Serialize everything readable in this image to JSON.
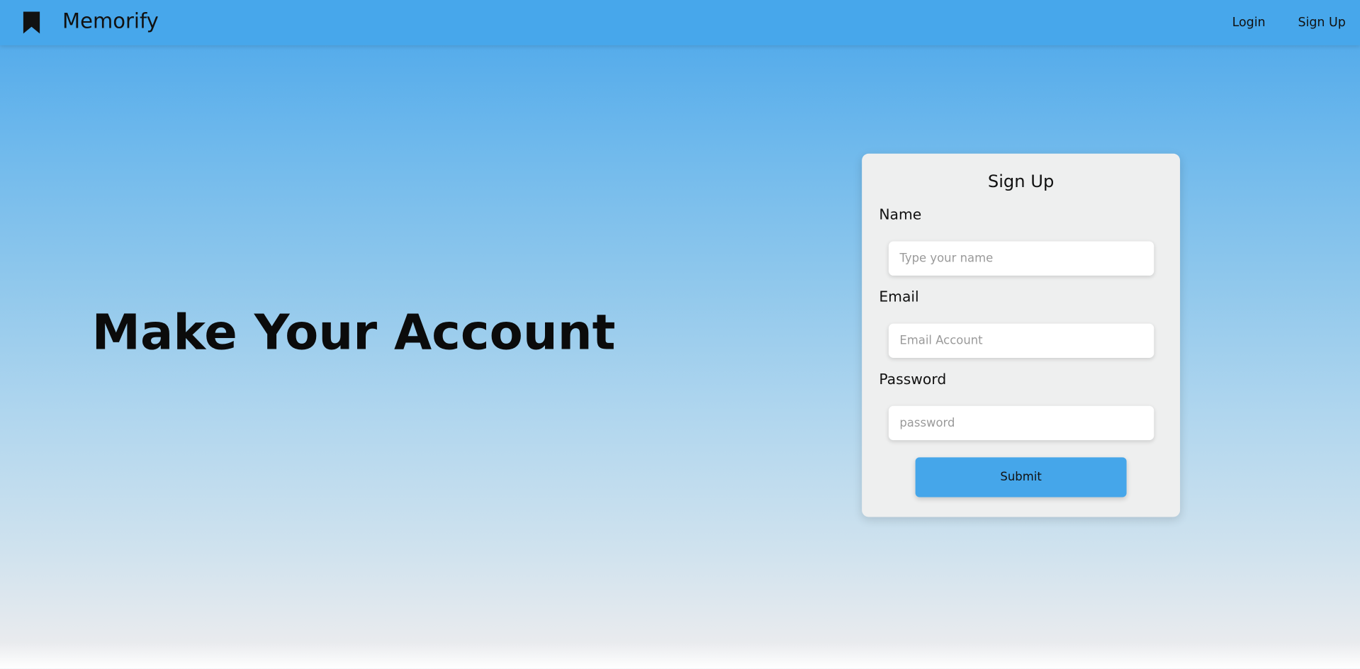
{
  "nav": {
    "brand_icon": "bookmark-icon",
    "brand": "Memorify",
    "login": "Login",
    "signup": "Sign Up"
  },
  "hero": {
    "title": "Make Your Account"
  },
  "form": {
    "title": "Sign Up",
    "name_label": "Name",
    "name_placeholder": "Type your name",
    "name_value": "",
    "email_label": "Email",
    "email_placeholder": "Email Account",
    "email_value": "",
    "password_label": "Password",
    "password_placeholder": "password",
    "password_value": "",
    "submit": "Submit"
  },
  "colors": {
    "nav_bg": "#47a7eb",
    "accent": "#45a6ea",
    "card_bg": "#eeefef"
  }
}
